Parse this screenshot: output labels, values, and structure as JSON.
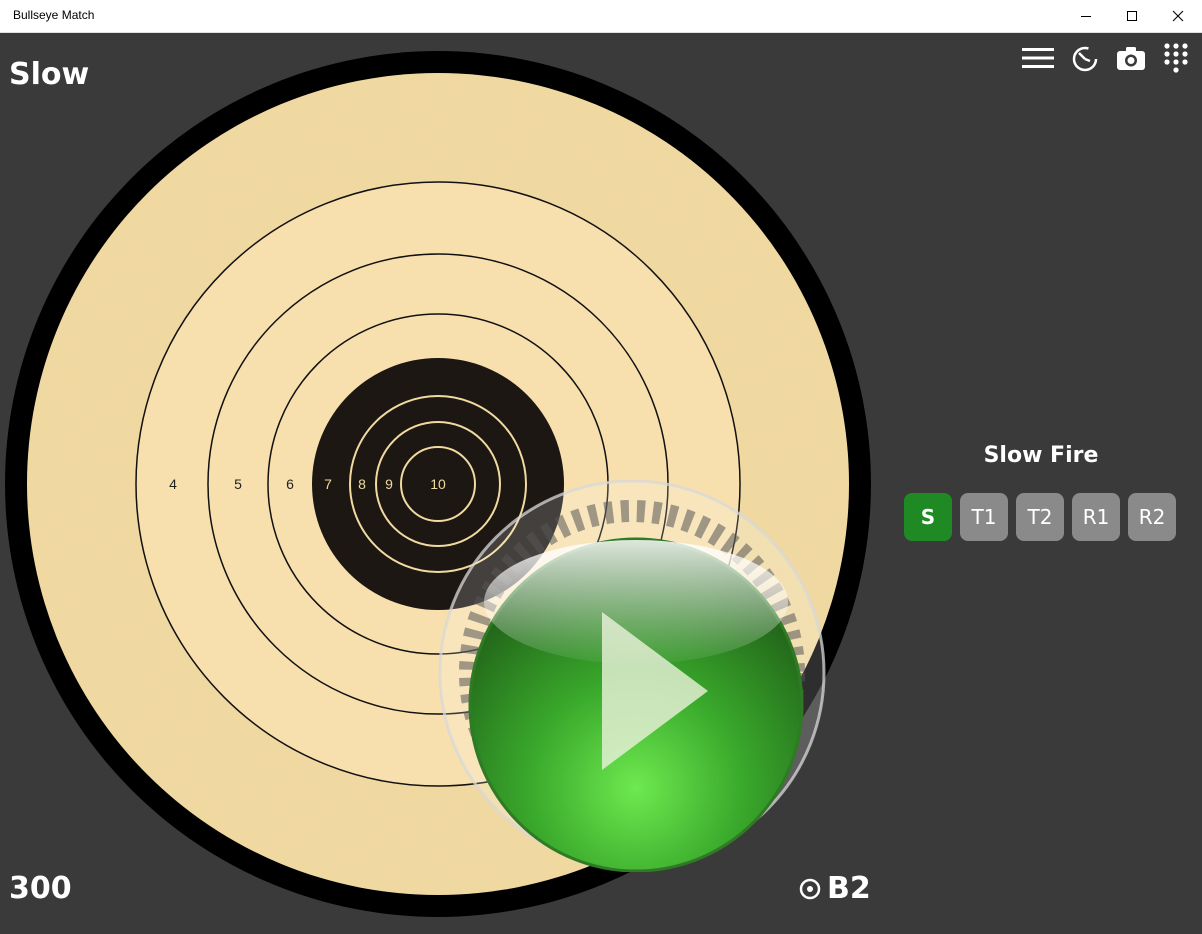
{
  "window": {
    "title": "Bullseye Match"
  },
  "header": {
    "mode": "Slow"
  },
  "toolbar": {
    "icons": [
      "menu-icon",
      "timer-icon",
      "camera-icon",
      "keypad-icon"
    ]
  },
  "target": {
    "ring_labels": [
      "4",
      "5",
      "6",
      "7",
      "8",
      "9",
      "10"
    ]
  },
  "stage": {
    "title": "Slow Fire",
    "buttons": [
      {
        "label": "S",
        "active": true
      },
      {
        "label": "T1",
        "active": false
      },
      {
        "label": "T2",
        "active": false
      },
      {
        "label": "R1",
        "active": false
      },
      {
        "label": "R2",
        "active": false
      }
    ]
  },
  "footer": {
    "score": "300",
    "target_id": "B2"
  },
  "colors": {
    "background": "#3a3a3a",
    "target_paper": "#f1d9a0",
    "active_button": "#1f8a24",
    "inactive_button": "#8a8a8a",
    "play_green": "#4ac23a"
  }
}
